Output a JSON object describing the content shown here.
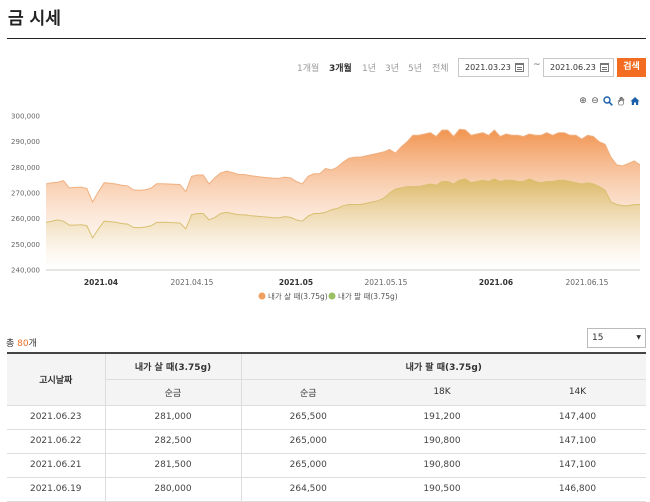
{
  "page_title": "금 시세",
  "periods": [
    "1개월",
    "3개월",
    "1년",
    "3년",
    "5년",
    "전체"
  ],
  "active_period": "3개월",
  "date_from": "2021.03.23",
  "date_sep": "~",
  "date_to": "2021.06.23",
  "search_label": "검색",
  "chart_tools": [
    "zoom-in-icon",
    "zoom-out-icon",
    "magnify-icon",
    "pan-hand-icon",
    "home-icon"
  ],
  "chart_data": {
    "type": "area",
    "ylim": [
      240000,
      300000
    ],
    "yticks": [
      "240,000",
      "250,000",
      "260,000",
      "270,000",
      "280,000",
      "290,000",
      "300,000"
    ],
    "xticks": [
      "2021.04",
      "2021.04.15",
      "2021.05",
      "2021.05.15",
      "2021.06",
      "2021.06.15"
    ],
    "xticks_bold": [
      true,
      false,
      true,
      false,
      true,
      false
    ],
    "colors": {
      "buy": "#f0a060",
      "sell": "#9cc064"
    },
    "series": [
      {
        "name": "내가 살 때(3.75g)",
        "values": [
          273500,
          274000,
          274200,
          274800,
          272000,
          272200,
          272300,
          271800,
          266500,
          270500,
          274000,
          273800,
          273500,
          273000,
          272800,
          271200,
          271000,
          271200,
          271800,
          273600,
          273600,
          273500,
          273400,
          273300,
          270500,
          276500,
          277000,
          277000,
          273500,
          276000,
          277800,
          278500,
          278000,
          277200,
          277200,
          276800,
          276500,
          276200,
          276000,
          275800,
          275700,
          276200,
          275900,
          274500,
          273500,
          276500,
          277500,
          277500,
          279500,
          279000,
          280000,
          282000,
          283500,
          284000,
          284000,
          284500,
          285000,
          285500,
          286000,
          287000,
          285500,
          288000,
          290000,
          292500,
          292500,
          293000,
          293500,
          292000,
          294500,
          294500,
          292000,
          294800,
          294600,
          292500,
          293000,
          293500,
          292500,
          294500,
          292000,
          293000,
          292500,
          292500,
          292000,
          293000,
          292500,
          292500,
          293500,
          292500,
          293500,
          293500,
          292500,
          292500,
          291000,
          292500,
          292000,
          290000,
          289000,
          284000,
          281000,
          280500,
          281500,
          282500,
          281000
        ]
      },
      {
        "name": "내가 팔 때(3.75g)",
        "values": [
          258500,
          259000,
          259500,
          259000,
          257500,
          257500,
          257600,
          257300,
          252500,
          256000,
          259000,
          258800,
          258600,
          258100,
          257900,
          256600,
          256500,
          256700,
          257200,
          258500,
          258600,
          258500,
          258400,
          258300,
          256000,
          261500,
          262000,
          262000,
          259500,
          260500,
          262000,
          262500,
          262000,
          261500,
          261500,
          261200,
          261000,
          260800,
          260600,
          260400,
          260300,
          260800,
          260500,
          259500,
          259000,
          261000,
          262000,
          262000,
          262500,
          263500,
          264000,
          265000,
          265500,
          265500,
          265500,
          266000,
          266500,
          267000,
          268000,
          270000,
          271500,
          272000,
          272500,
          272500,
          272500,
          273000,
          273500,
          273000,
          274500,
          274500,
          273500,
          275000,
          275500,
          274000,
          274500,
          275000,
          274500,
          275500,
          274500,
          275000,
          275000,
          274500,
          274500,
          275500,
          274500,
          274000,
          274500,
          274500,
          275000,
          275000,
          274500,
          274000,
          273500,
          274000,
          273500,
          272500,
          271000,
          266500,
          265500,
          265000,
          265000,
          265500,
          265500
        ]
      }
    ]
  },
  "total": {
    "prefix": "총 ",
    "count": "80",
    "suffix": "개"
  },
  "page_size": "15",
  "table": {
    "h_date": "고시날짜",
    "h_buy": "내가 살 때(3.75g)",
    "h_sell": "내가 팔 때(3.75g)",
    "h_buy_pure": "순금",
    "h_sell_pure": "순금",
    "h_18k": "18K",
    "h_14k": "14K",
    "rows": [
      [
        "2021.06.23",
        "281,000",
        "265,500",
        "191,200",
        "147,400"
      ],
      [
        "2021.06.22",
        "282,500",
        "265,000",
        "190,800",
        "147,100"
      ],
      [
        "2021.06.21",
        "281,500",
        "265,000",
        "190,800",
        "147,100"
      ],
      [
        "2021.06.19",
        "280,000",
        "264,500",
        "190,500",
        "146,800"
      ]
    ]
  }
}
